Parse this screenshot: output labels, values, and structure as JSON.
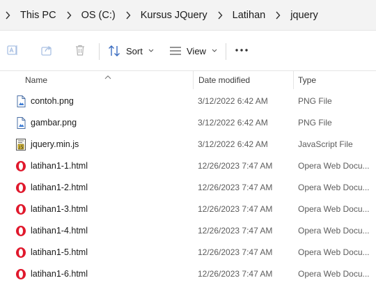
{
  "address_bar": {
    "crumbs": [
      "This PC",
      "OS (C:)",
      "Kursus JQuery",
      "Latihan",
      "jquery"
    ]
  },
  "toolbar": {
    "sort_label": "Sort",
    "view_label": "View",
    "icons": [
      "rename-icon",
      "share-icon",
      "delete-icon",
      "sort-icon",
      "view-icon",
      "more-icon"
    ]
  },
  "columns": {
    "name": "Name",
    "date_modified": "Date modified",
    "type": "Type"
  },
  "files": [
    {
      "name": "contoh.png",
      "date": "3/12/2022 6:42 AM",
      "type": "PNG File",
      "icon": "png-file-icon"
    },
    {
      "name": "gambar.png",
      "date": "3/12/2022 6:42 AM",
      "type": "PNG File",
      "icon": "png-file-icon"
    },
    {
      "name": "jquery.min.js",
      "date": "3/12/2022 6:42 AM",
      "type": "JavaScript File",
      "icon": "js-file-icon"
    },
    {
      "name": "latihan1-1.html",
      "date": "12/26/2023 7:47 AM",
      "type": "Opera Web Docu...",
      "icon": "opera-icon"
    },
    {
      "name": "latihan1-2.html",
      "date": "12/26/2023 7:47 AM",
      "type": "Opera Web Docu...",
      "icon": "opera-icon"
    },
    {
      "name": "latihan1-3.html",
      "date": "12/26/2023 7:47 AM",
      "type": "Opera Web Docu...",
      "icon": "opera-icon"
    },
    {
      "name": "latihan1-4.html",
      "date": "12/26/2023 7:47 AM",
      "type": "Opera Web Docu...",
      "icon": "opera-icon"
    },
    {
      "name": "latihan1-5.html",
      "date": "12/26/2023 7:47 AM",
      "type": "Opera Web Docu...",
      "icon": "opera-icon"
    },
    {
      "name": "latihan1-6.html",
      "date": "12/26/2023 7:47 AM",
      "type": "Opera Web Docu...",
      "icon": "opera-icon"
    }
  ],
  "colors": {
    "address_bg": "#f3f3f3",
    "opera_red": "#e0182c",
    "toolbar_accent": "#3a6cc0",
    "secondary_text": "#5c5c5c"
  }
}
